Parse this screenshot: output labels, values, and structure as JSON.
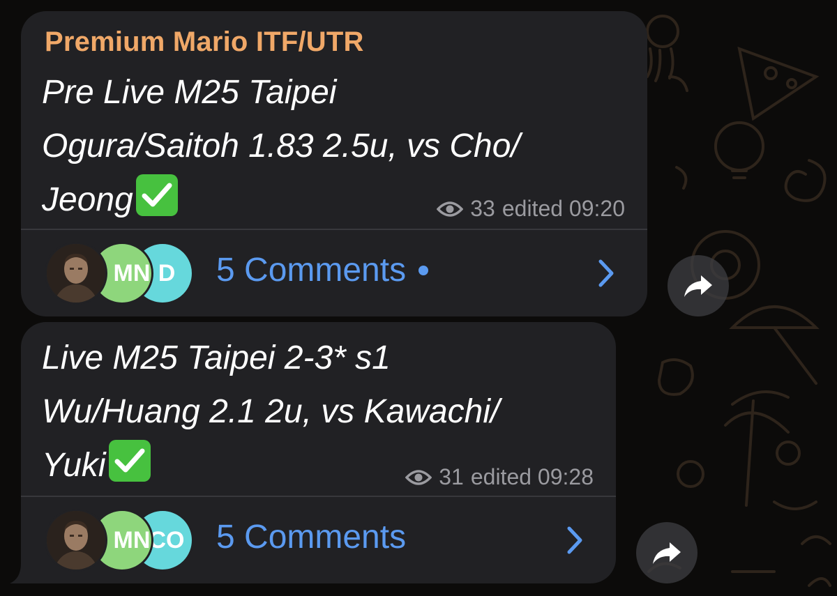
{
  "messages": [
    {
      "sender": "Premium Mario ITF/UTR",
      "lines": [
        "Pre Live M25 Taipei",
        "Ogura/Saitoh 1.83 2.5u, vs Cho/",
        "Jeong"
      ],
      "status_emoji": "check-mark-button",
      "views": "33",
      "meta_label": "edited 09:20",
      "avatars": [
        {
          "type": "photo",
          "initials": ""
        },
        {
          "type": "initials",
          "initials": "MN",
          "color": "#8ed67c"
        },
        {
          "type": "initials",
          "initials": "D",
          "color": "#66d8dc"
        }
      ],
      "comments_label": "5 Comments",
      "unread_dot": true
    },
    {
      "sender": "",
      "lines": [
        "Live M25 Taipei 2-3* s1",
        "Wu/Huang 2.1 2u, vs Kawachi/",
        "Yuki"
      ],
      "status_emoji": "check-mark-button",
      "views": "31",
      "meta_label": "edited 09:28",
      "avatars": [
        {
          "type": "photo",
          "initials": ""
        },
        {
          "type": "initials",
          "initials": "MN",
          "color": "#8ed67c"
        },
        {
          "type": "initials",
          "initials": "CO",
          "color": "#66d8dc"
        }
      ],
      "comments_label": "5 Comments",
      "unread_dot": false
    }
  ],
  "colors": {
    "background": "#0c0b0a",
    "bubble": "#212124",
    "sender": "#f0a868",
    "link": "#5b9af0",
    "meta": "#9b9ba0",
    "check": "#47c13f"
  },
  "icons": [
    "eye-icon",
    "chevron-right-icon",
    "share-arrow-icon",
    "check-mark-button"
  ]
}
